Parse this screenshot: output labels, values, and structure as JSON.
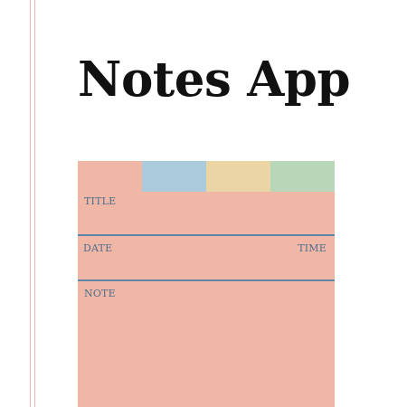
{
  "app": {
    "title": "Notes App"
  },
  "card": {
    "tabs": [
      {
        "name": "blue",
        "color": "#a9cbdc"
      },
      {
        "name": "yellow",
        "color": "#ebd5a4"
      },
      {
        "name": "green",
        "color": "#b7d7b8"
      }
    ],
    "labels": {
      "title": "TITLE",
      "date": "DATE",
      "time": "TIME",
      "note": "NOTE"
    }
  },
  "colors": {
    "card": "#f0b7a6",
    "divider": "#5f86a6",
    "label": "#4d6d8c",
    "margin_line": "#e9b8b8"
  }
}
